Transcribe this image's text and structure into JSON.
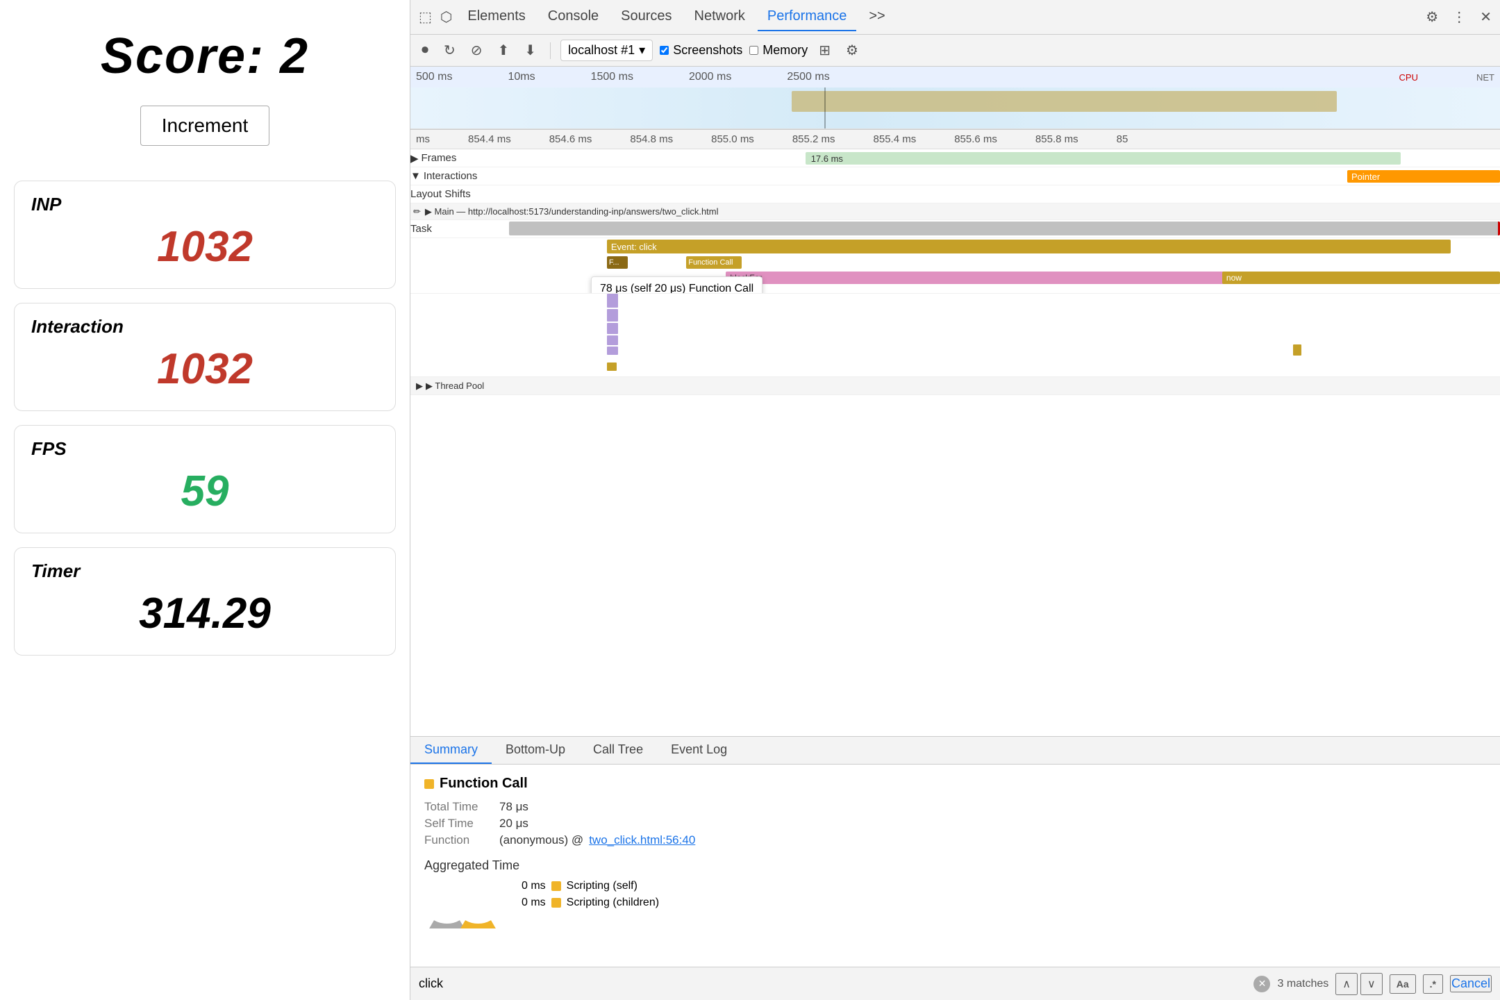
{
  "left": {
    "score_label": "Score: 2",
    "increment_btn": "Increment",
    "metrics": [
      {
        "id": "inp",
        "label": "INP",
        "value": "1032",
        "color": "red"
      },
      {
        "id": "interaction",
        "label": "Interaction",
        "value": "1032",
        "color": "red"
      },
      {
        "id": "fps",
        "label": "FPS",
        "value": "59",
        "color": "green"
      },
      {
        "id": "timer",
        "label": "Timer",
        "value": "314.29",
        "color": "black"
      }
    ]
  },
  "devtools": {
    "tabs": [
      "Elements",
      "Console",
      "Sources",
      "Network",
      "Performance",
      ">>"
    ],
    "active_tab": "Performance",
    "toolbar": {
      "url": "localhost #1",
      "screenshots_label": "Screenshots",
      "memory_label": "Memory"
    },
    "timeline": {
      "ruler_marks": [
        "500 ms",
        "10ms",
        "1500 ms",
        "2000 ms",
        "2500 ms"
      ],
      "detail_ruler_marks": [
        "ms",
        "854.4 ms",
        "854.6 ms",
        "854.8 ms",
        "855.0 ms",
        "855.2 ms",
        "855.4 ms",
        "855.6 ms",
        "855.8 ms",
        "85"
      ],
      "tracks": {
        "frames_label": "Frames",
        "frames_value": "17.6 ms",
        "interactions_label": "Interactions",
        "interaction_name": "Pointer",
        "layout_shifts_label": "Layout Shifts",
        "main_label": "▶ Main — http://localhost:5173/understanding-inp/answers/two_click.html",
        "task_label": "Task",
        "event_label": "Event: click",
        "function_call_label": "Function Call",
        "blocklor_label": "blockFor",
        "now_label": "now",
        "thread_pool_label": "▶ Thread Pool"
      }
    },
    "tooltip": {
      "text": "78 μs (self 20 μs)  Function Call"
    },
    "bottom": {
      "tabs": [
        "Summary",
        "Bottom-Up",
        "Call Tree",
        "Event Log"
      ],
      "active_tab": "Summary",
      "summary": {
        "title": "Function Call",
        "color": "#f0b429",
        "total_time_label": "Total Time",
        "total_time_value": "78 μs",
        "self_time_label": "Self Time",
        "self_time_value": "20 μs",
        "function_label": "Function",
        "function_value": "(anonymous) @ two_click.html:56:40",
        "function_link": "two_click.html:56:40"
      },
      "aggregated": {
        "title": "Aggregated Time",
        "legend": [
          {
            "label": "Scripting (self)",
            "value": "0 ms",
            "color": "#f0b429"
          },
          {
            "label": "Scripting (children)",
            "value": "0 ms",
            "color": "#f0b429"
          }
        ]
      }
    },
    "search": {
      "placeholder": "click",
      "matches": "3 matches",
      "cancel_label": "Cancel",
      "aa_label": "Aa",
      "regex_label": ".*"
    }
  }
}
